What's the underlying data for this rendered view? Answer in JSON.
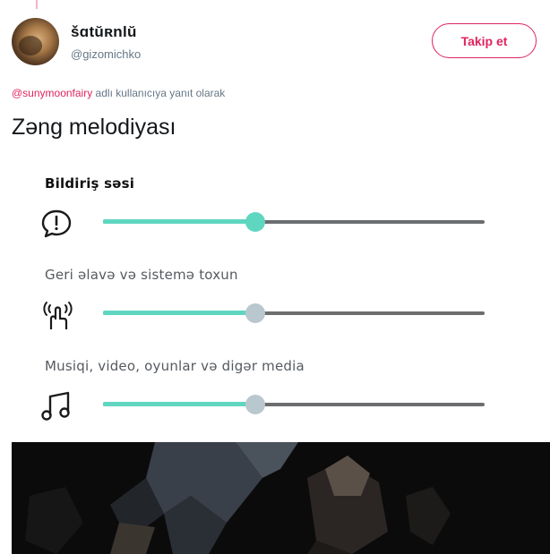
{
  "author": {
    "display_name": "šɑtŭʀnlŭ",
    "username": "@gizomichko"
  },
  "follow_button": {
    "label": "Takip et"
  },
  "reply_context": {
    "mention": "@sunymoonfairy",
    "text": " adlı kullanıcıya yanıt olarak"
  },
  "tweet_text": "Zəng melodiyası",
  "settings": {
    "rows": [
      {
        "label": "Bildiriş səsi",
        "icon": "notification-alert-icon",
        "level": 0.4,
        "thumb_color": "#5fd6c0"
      },
      {
        "label": "Geri əlavə və sistemə toxun",
        "icon": "touch-vibration-icon",
        "level": 0.4,
        "thumb_color": "#b9c7cf"
      },
      {
        "label": "Musiqi, video, oyunlar və digər media",
        "icon": "music-note-icon",
        "level": 0.4,
        "thumb_color": "#b9c7cf"
      }
    ]
  },
  "colors": {
    "accent": "#e0245e",
    "slider_fill": "#5fd6c0",
    "slider_track": "#6b6d6f"
  }
}
